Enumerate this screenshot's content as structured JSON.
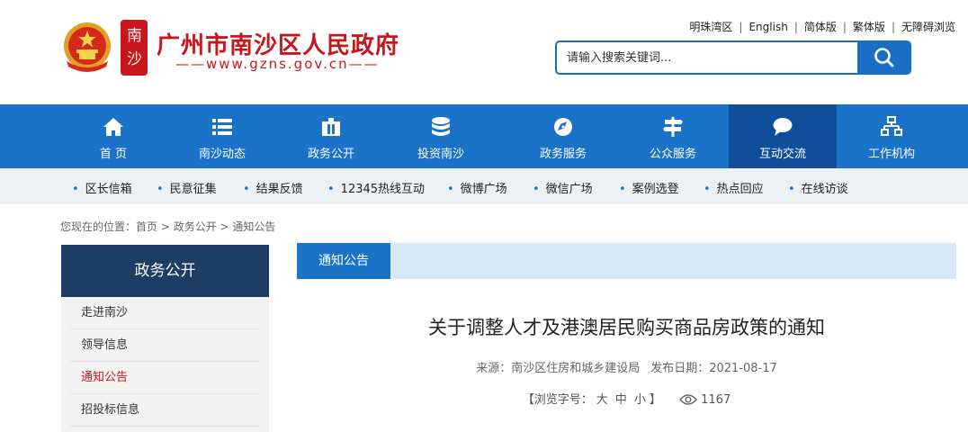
{
  "header": {
    "site_title": "广州市南沙区人民政府",
    "site_url": "——www.gzns.gov.cn——",
    "seal_text": "南沙",
    "top_links": [
      "明珠湾区",
      "English",
      "简体版",
      "繁体版",
      "无障碍浏览"
    ],
    "search": {
      "placeholder": "请输入搜索关键词..."
    }
  },
  "nav": {
    "items": [
      {
        "label": "首 页",
        "icon": "home-icon"
      },
      {
        "label": "南沙动态",
        "icon": "list-icon"
      },
      {
        "label": "政务公开",
        "icon": "document-icon"
      },
      {
        "label": "投资南沙",
        "icon": "database-icon"
      },
      {
        "label": "政务服务",
        "icon": "compass-icon"
      },
      {
        "label": "公众服务",
        "icon": "signpost-icon"
      },
      {
        "label": "互动交流",
        "icon": "chat-icon"
      },
      {
        "label": "工作机构",
        "icon": "org-chart-icon"
      }
    ],
    "active_index": 6
  },
  "subnav": {
    "items": [
      "区长信箱",
      "民意征集",
      "结果反馈",
      "12345热线互动",
      "微博广场",
      "微信广场",
      "案例选登",
      "热点回应",
      "在线访谈"
    ]
  },
  "breadcrumb": {
    "prefix": "您现在的位置：",
    "items": [
      "首页",
      "政务公开",
      "通知公告"
    ],
    "separator": " > "
  },
  "sidebar": {
    "title": "政务公开",
    "items": [
      "走进南沙",
      "领导信息",
      "通知公告",
      "招投标信息"
    ],
    "active_index": 2
  },
  "article": {
    "tab_label": "通知公告",
    "title": "关于调整人才及港澳居民购买商品房政策的通知",
    "source": "来源：南沙区住房和城乡建设局",
    "publish_date": "发布日期：2021-08-17",
    "font_size_label": "【浏览字号：",
    "font_sizes": [
      "大",
      "中",
      "小"
    ],
    "font_size_close": "】",
    "views": "1167"
  },
  "colors": {
    "brand_red": "#c8161d",
    "nav_blue": "#1a73c8",
    "nav_active": "#0f4e9a",
    "sidebar_head": "#1e3d64"
  }
}
